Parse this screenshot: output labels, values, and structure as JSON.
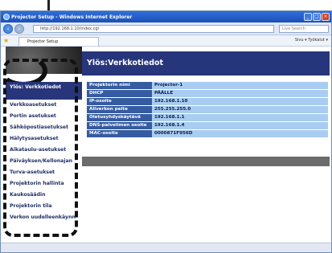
{
  "window": {
    "title": "Projector Setup - Windows Internet Explorer",
    "address": "http://192.168.1.10/index.cgi",
    "search_placeholder": "Live Search",
    "tab_title": "Projector Setup",
    "toolbar_text": "Sivu ▾  Työkalut ▾",
    "status": ""
  },
  "sidebar": {
    "items": [
      {
        "label": "Ylös: Verkkotiedot"
      },
      {
        "label": "Verkkoasetukset"
      },
      {
        "label": "Portin asetukset"
      },
      {
        "label": "Sähköpostiasetukset"
      },
      {
        "label": "Hälytysasetukset"
      },
      {
        "label": "Aikataulu-asetukset"
      },
      {
        "label": "Päiväyksen/Kellonajan"
      },
      {
        "label": "Turva-asetukset"
      },
      {
        "label": "Projektorin hallinta"
      },
      {
        "label": "Kaukosäädin"
      },
      {
        "label": "Projektorin tila"
      },
      {
        "label": "Verkon uudelleenkäynn"
      }
    ]
  },
  "main": {
    "title": "Ylös:Verkkotiedot",
    "rows": [
      {
        "key": "Projektorin nimi",
        "value": "Projector-1"
      },
      {
        "key": "DHCP",
        "value": "PÄÄLLE"
      },
      {
        "key": "IP-osoite",
        "value": "192.168.1.10"
      },
      {
        "key": "Aliverkon peite",
        "value": "255.255.255.0"
      },
      {
        "key": "Oletusyhdyskäytävä",
        "value": "192.168.1.1"
      },
      {
        "key": "DNS-palvelimen osoite",
        "value": "192.168.1.4"
      },
      {
        "key": "MAC-osoite",
        "value": "0000871F956D"
      }
    ]
  },
  "colors": {
    "header_bg": "#27357a",
    "key_bg": "#355ba1",
    "value_bg": "#a9ccf3",
    "band_bg": "#6c6c6c"
  }
}
